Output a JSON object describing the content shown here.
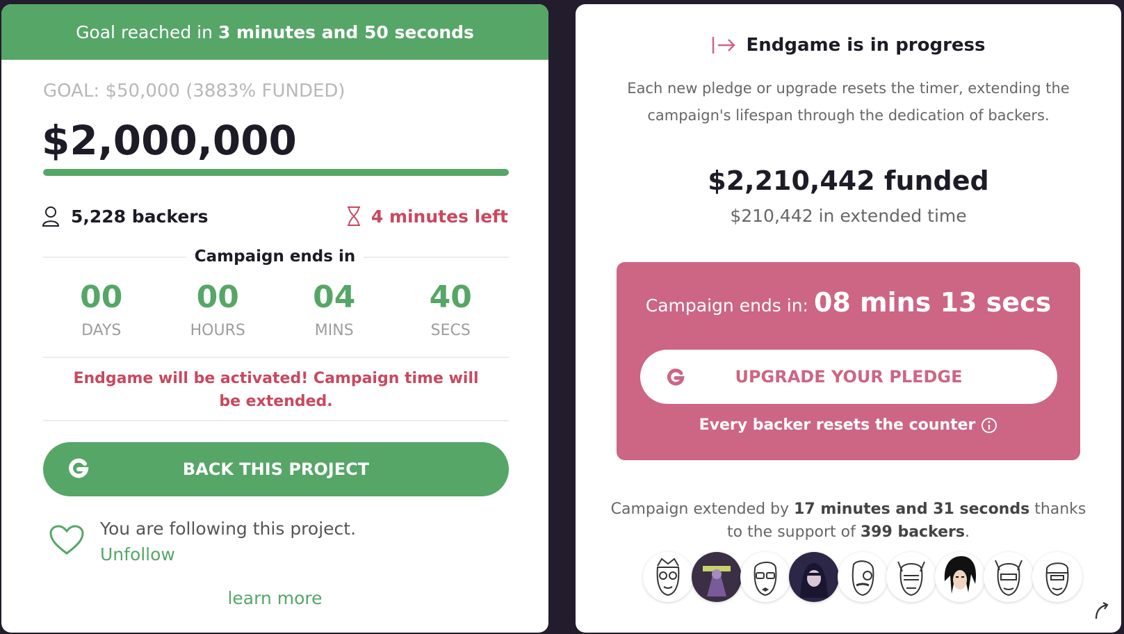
{
  "left": {
    "banner_prefix": "Goal reached in",
    "banner_time": "3 minutes and 50 seconds",
    "goal": "GOAL: $50,000 (3883% FUNDED)",
    "amount": "$2,000,000",
    "progress_fraction": 1.0,
    "backers": "5,228 backers",
    "time_left": "4 minutes left",
    "ends_title": "Campaign ends in",
    "countdown": [
      {
        "value": "00",
        "label": "DAYS"
      },
      {
        "value": "00",
        "label": "HOURS"
      },
      {
        "value": "04",
        "label": "MINS"
      },
      {
        "value": "40",
        "label": "SECS"
      }
    ],
    "warning": "Endgame will be activated! Campaign time will be extended.",
    "back_button": "BACK THIS PROJECT",
    "following_text": "You are following this project.",
    "unfollow": "Unfollow",
    "learn_more": "learn more"
  },
  "right": {
    "title": "Endgame is in progress",
    "description": "Each new pledge or upgrade resets the timer, extending the campaign's lifespan through the dedication of backers.",
    "funded": "$2,210,442 funded",
    "extended": "$210,442 in extended time",
    "ends_prefix": "Campaign ends in:",
    "ends_time": "08 mins 13 secs",
    "upgrade_button": "UPGRADE YOUR PLEDGE",
    "resets_text": "Every backer resets the counter",
    "extended_by_prefix": "Campaign extended by",
    "extended_by_time": "17 minutes and 31 seconds",
    "extended_by_middle": "thanks to the support of",
    "extended_by_backers": "399 backers",
    "extended_by_suffix": "."
  },
  "colors": {
    "green": "#56a667",
    "pink": "#cd6584",
    "red_text": "#c9485f",
    "background": "#221c2c"
  }
}
